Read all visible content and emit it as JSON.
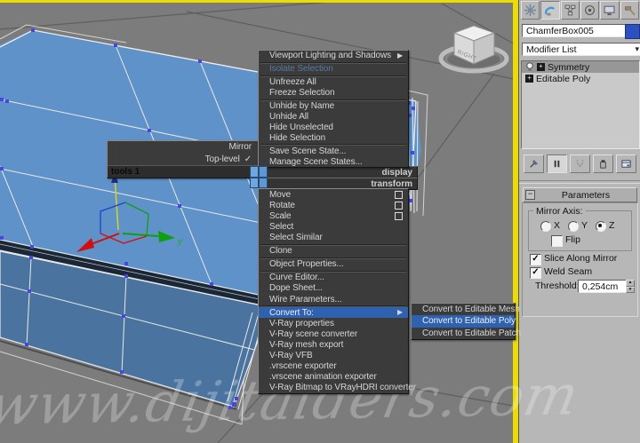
{
  "viewport": {
    "watermark": "www.dijitalders.com",
    "axis_label_y": "y",
    "viewcube_label": "RIGHT",
    "colors": {
      "background": "#7c7c7c",
      "box_top_face": "#5f92c8",
      "box_front_face": "#4a749f",
      "chamfer_band": "#1a2736",
      "wireframe": "#e9e9e9",
      "vertex_dot": "#4747e0",
      "active_border": "#eddc00",
      "gizmo_x": "#cf1010",
      "gizmo_y": "#0f9f0f",
      "gizmo_z": "#d6d22a"
    }
  },
  "quad_menu": {
    "tools_title": "tools 1",
    "tools_items": [
      {
        "label": "Mirror"
      },
      {
        "label": "Top-level",
        "checked": true
      }
    ],
    "display_title": "display",
    "transform_title": "transform",
    "quad_square_colors": [
      "#6fa6e0",
      "#5d97d6",
      "#6fa6e0",
      "#5d97d6"
    ]
  },
  "display_menu": {
    "items": [
      {
        "label": "Viewport Lighting and Shadows",
        "submenu": true,
        "sep": true
      },
      {
        "label": "Isolate Selection",
        "disabled": true,
        "sep": true
      },
      {
        "label": "Unfreeze All"
      },
      {
        "label": "Freeze Selection",
        "sep": true
      },
      {
        "label": "Unhide by Name"
      },
      {
        "label": "Unhide All"
      },
      {
        "label": "Hide Unselected"
      },
      {
        "label": "Hide Selection",
        "sep": true
      },
      {
        "label": "Save Scene State..."
      },
      {
        "label": "Manage Scene States..."
      }
    ]
  },
  "transform_menu": {
    "items": [
      {
        "label": "Move",
        "settings": true
      },
      {
        "label": "Rotate",
        "settings": true
      },
      {
        "label": "Scale",
        "settings": true
      },
      {
        "label": "Select"
      },
      {
        "label": "Select Similar",
        "sep": true
      },
      {
        "label": "Clone",
        "sep": true
      },
      {
        "label": "Object Properties...",
        "sep": true
      },
      {
        "label": "Curve Editor..."
      },
      {
        "label": "Dope Sheet..."
      },
      {
        "label": "Wire Parameters...",
        "sep": true
      },
      {
        "label": "Convert To:",
        "submenu": true,
        "highlight": true
      },
      {
        "label": "V-Ray properties"
      },
      {
        "label": "V-Ray scene converter"
      },
      {
        "label": "V-Ray mesh export"
      },
      {
        "label": "V-Ray VFB"
      },
      {
        "label": ".vrscene exporter"
      },
      {
        "label": ".vrscene animation exporter"
      },
      {
        "label": "V-Ray Bitmap to VRayHDRI converter"
      }
    ]
  },
  "convert_submenu": {
    "items": [
      {
        "label": "Convert to Editable Mesh"
      },
      {
        "label": "Convert to Editable Poly",
        "highlight": true
      },
      {
        "label": "Convert to Editable Patch"
      }
    ],
    "highlight_color": "#3f80d8"
  },
  "panel": {
    "tabs": [
      "create",
      "modify",
      "hierarchy",
      "motion",
      "display",
      "utilities"
    ],
    "active_tab": "modify",
    "object_name": "ChamferBox005",
    "object_color": "#2b50bf",
    "modifier_list_label": "Modifier List",
    "stack": [
      {
        "label": "Symmetry",
        "bulb": true,
        "selected": true
      },
      {
        "label": "Editable Poly"
      }
    ],
    "stack_toolbar": [
      "pin-stack",
      "show-end-result",
      "make-unique",
      "remove-modifier",
      "configure-modifier-sets"
    ],
    "rollout_title": "Parameters",
    "mirror_axis_label": "Mirror Axis:",
    "radio_x": "X",
    "radio_y": "Y",
    "radio_z": "Z",
    "selected_axis": "Z",
    "flip_label": "Flip",
    "flip_checked": false,
    "slice_label": "Slice Along Mirror",
    "slice_checked": true,
    "weld_label": "Weld Seam",
    "weld_checked": true,
    "threshold_label": "Threshold:",
    "threshold_value": "0,254cm"
  }
}
